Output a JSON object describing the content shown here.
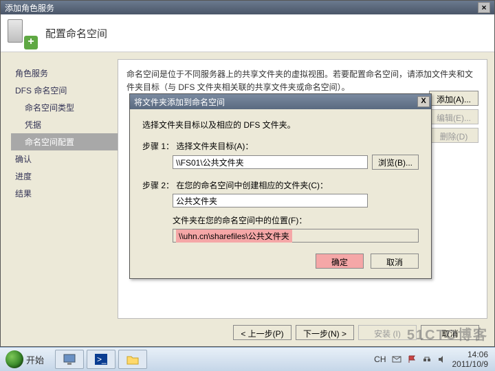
{
  "main_window": {
    "title": "添加角色服务",
    "header_title": "配置命名空间"
  },
  "sidebar": {
    "items": [
      {
        "label": "角色服务",
        "level": 1
      },
      {
        "label": "DFS 命名空间",
        "level": 1
      },
      {
        "label": "命名空间类型",
        "level": 2
      },
      {
        "label": "凭据",
        "level": 2
      },
      {
        "label": "命名空间配置",
        "level": 2,
        "selected": true
      },
      {
        "label": "确认",
        "level": 1
      },
      {
        "label": "进度",
        "level": 1
      },
      {
        "label": "结果",
        "level": 1
      }
    ]
  },
  "content": {
    "description": "命名空间是位于不同服务器上的共享文件夹的虚拟视图。若要配置命名空间，请添加文件夹和文件夹目标（与 DFS 文件夹相关联的共享文件夹或命名空间）。",
    "buttons": {
      "add": "添加(A)...",
      "edit": "编辑(E)...",
      "delete": "删除(D)"
    }
  },
  "footer": {
    "prev": "< 上一步(P)",
    "next": "下一步(N) >",
    "install": "安装 (I)",
    "cancel": "取消"
  },
  "dialog": {
    "title": "将文件夹添加到命名空间",
    "intro": "选择文件夹目标以及相应的 DFS 文件夹。",
    "step1_label": "步骤 1：  选择文件夹目标(A)：",
    "step1_value": "\\\\FS01\\公共文件夹",
    "browse": "浏览(B)...",
    "step2_label": "步骤 2：  在您的命名空间中创建相应的文件夹(C)：",
    "step2_value": "公共文件夹",
    "loc_label": "文件夹在您的命名空间中的位置(F)：",
    "loc_value": "\\\\uhn.cn\\sharefiles\\公共文件夹",
    "ok": "确定",
    "cancel": "取消"
  },
  "taskbar": {
    "start": "开始",
    "lang": "CH",
    "time": "14:06",
    "date": "2011/10/9"
  },
  "watermark": "51CTO博客"
}
